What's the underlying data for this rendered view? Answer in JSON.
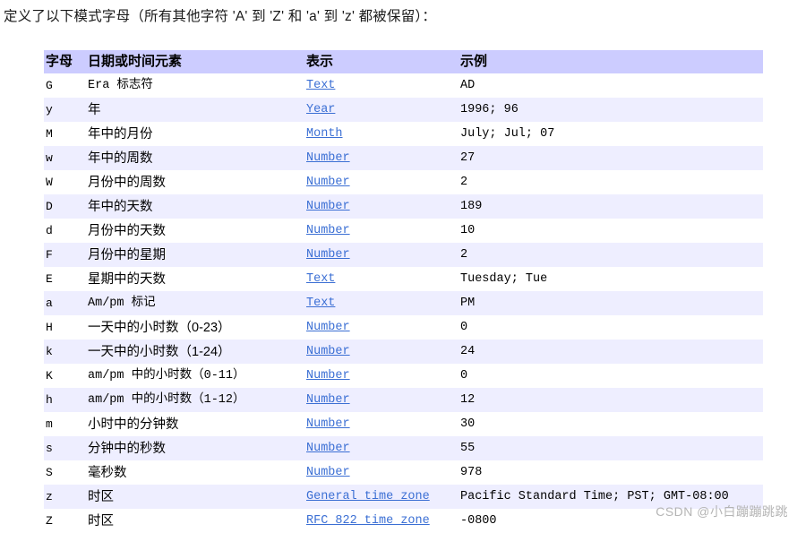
{
  "intro": "定义了以下模式字母（所有其他字符 'A' 到 'Z' 和 'a' 到 'z' 都被保留）：",
  "colors": {
    "header_bg": "#ccccff",
    "alt_row_bg": "#eeeeff",
    "link": "#3b6fd4",
    "text": "#000000",
    "watermark": "#b5b5b5"
  },
  "table": {
    "headers": {
      "letter": "字母",
      "element": "日期或时间元素",
      "presentation": "表示",
      "example": "示例"
    },
    "rows": [
      {
        "letter": "G",
        "element": "Era 标志符",
        "presentation": "Text",
        "example": "AD"
      },
      {
        "letter": "y",
        "element": "年",
        "presentation": "Year",
        "example": "1996; 96"
      },
      {
        "letter": "M",
        "element": "年中的月份",
        "presentation": "Month",
        "example": "July; Jul; 07"
      },
      {
        "letter": "w",
        "element": "年中的周数",
        "presentation": "Number",
        "example": "27"
      },
      {
        "letter": "W",
        "element": "月份中的周数",
        "presentation": "Number",
        "example": "2"
      },
      {
        "letter": "D",
        "element": "年中的天数",
        "presentation": "Number",
        "example": "189"
      },
      {
        "letter": "d",
        "element": "月份中的天数",
        "presentation": "Number",
        "example": "10"
      },
      {
        "letter": "F",
        "element": "月份中的星期",
        "presentation": "Number",
        "example": "2"
      },
      {
        "letter": "E",
        "element": "星期中的天数",
        "presentation": "Text",
        "example": "Tuesday; Tue"
      },
      {
        "letter": "a",
        "element": "Am/pm 标记",
        "presentation": "Text",
        "example": "PM"
      },
      {
        "letter": "H",
        "element": "一天中的小时数（0-23）",
        "presentation": "Number",
        "example": "0"
      },
      {
        "letter": "k",
        "element": "一天中的小时数（1-24）",
        "presentation": "Number",
        "example": "24"
      },
      {
        "letter": "K",
        "element": "am/pm 中的小时数（0-11）",
        "presentation": "Number",
        "example": "0"
      },
      {
        "letter": "h",
        "element": "am/pm 中的小时数（1-12）",
        "presentation": "Number",
        "example": "12"
      },
      {
        "letter": "m",
        "element": "小时中的分钟数",
        "presentation": "Number",
        "example": "30"
      },
      {
        "letter": "s",
        "element": "分钟中的秒数",
        "presentation": "Number",
        "example": "55"
      },
      {
        "letter": "S",
        "element": "毫秒数",
        "presentation": "Number",
        "example": "978"
      },
      {
        "letter": "z",
        "element": "时区",
        "presentation": "General time zone",
        "example": "Pacific Standard Time; PST; GMT-08:00"
      },
      {
        "letter": "Z",
        "element": "时区",
        "presentation": "RFC 822 time zone",
        "example": "-0800"
      }
    ]
  },
  "watermark": "CSDN @小白蹦蹦跳跳"
}
